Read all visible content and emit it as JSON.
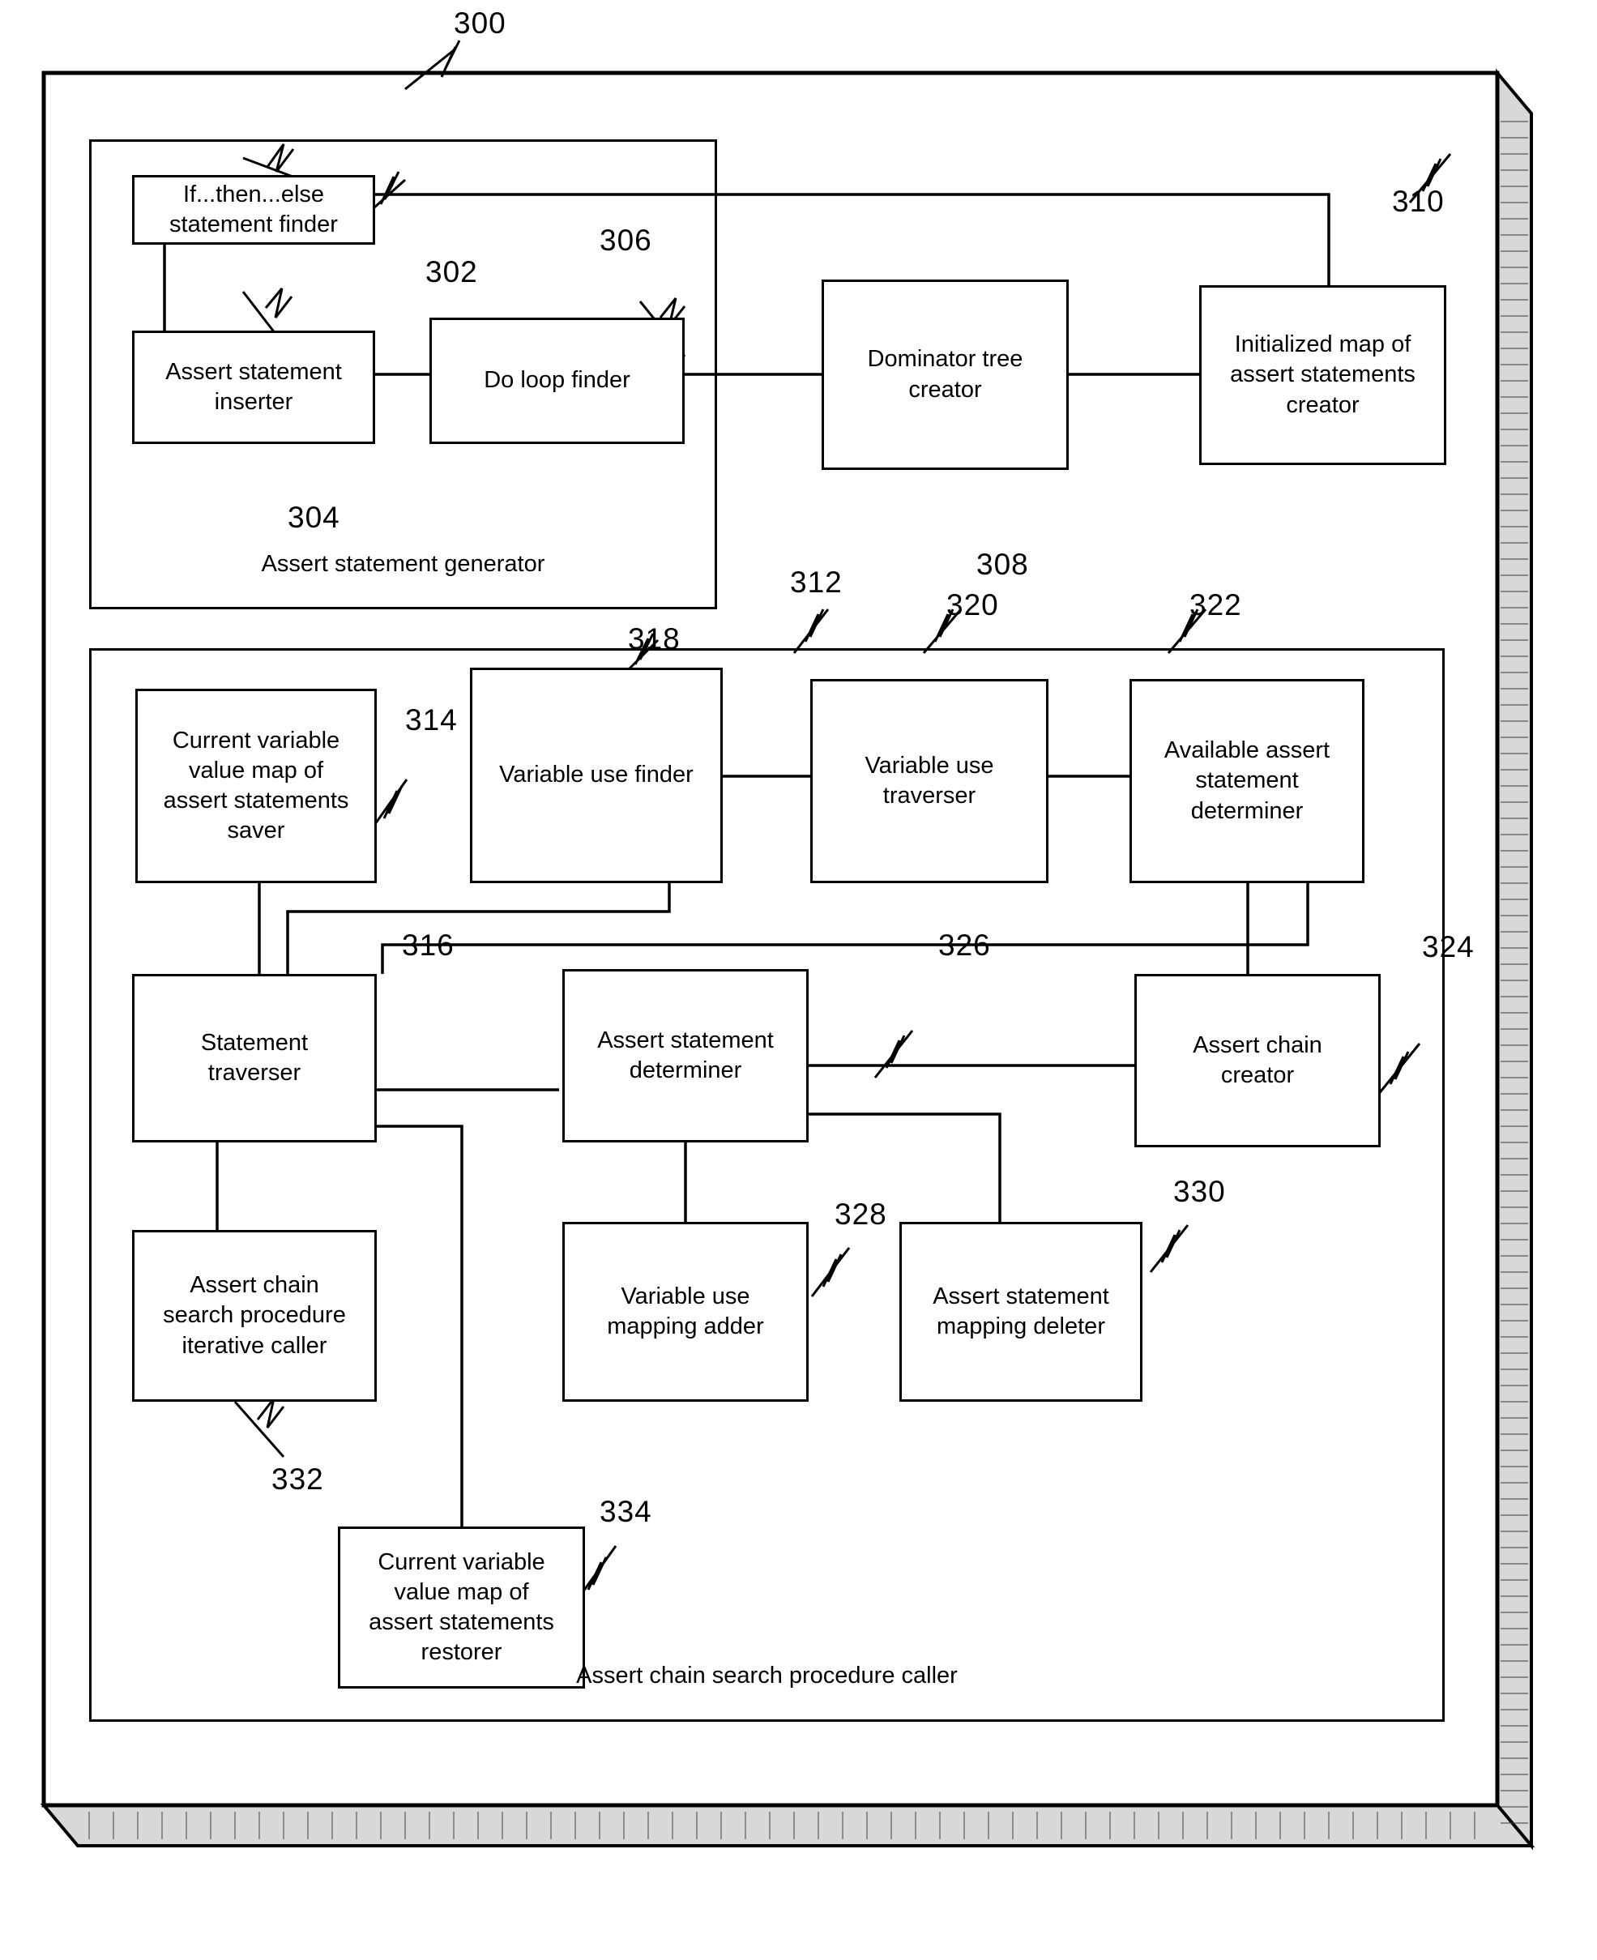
{
  "figure": {
    "main_ref": "300",
    "outer_frame": {
      "name": "system-frame"
    },
    "groups": [
      {
        "id": "assert-statement-generator",
        "label": "Assert statement generator"
      },
      {
        "id": "assert-chain-search-procedure-caller",
        "label": "Assert chain search procedure caller"
      }
    ],
    "nodes": [
      {
        "id": "if-then-else-statement-finder",
        "label": "If...then...else statement finder",
        "ref": "302"
      },
      {
        "id": "assert-statement-inserter",
        "label": "Assert statement inserter",
        "ref": "304"
      },
      {
        "id": "do-loop-finder",
        "label": "Do loop finder",
        "ref": "306"
      },
      {
        "id": "dominator-tree-creator",
        "label": "Dominator tree creator",
        "ref": "308"
      },
      {
        "id": "initialized-map-of-assert-statements-creator",
        "label": "Initialized map of assert statements creator",
        "ref": "310"
      },
      {
        "id": "current-variable-value-map-of-assert-statements-saver",
        "label": "Current variable value map of assert statements saver",
        "ref": "314"
      },
      {
        "id": "variable-use-finder",
        "label": "Variable use finder",
        "ref": "318"
      },
      {
        "id": "variable-use-traverser",
        "label": "Variable use traverser",
        "ref": "320"
      },
      {
        "id": "available-assert-statement-determiner",
        "label": "Available assert statement determiner",
        "ref": "322"
      },
      {
        "id": "statement-traverser",
        "label": "Statement traverser",
        "ref": "316"
      },
      {
        "id": "assert-statement-determiner",
        "label": "Assert statement determiner",
        "ref": "326"
      },
      {
        "id": "assert-chain-creator",
        "label": "Assert chain creator",
        "ref": "324"
      },
      {
        "id": "assert-chain-search-procedure-iterative-caller",
        "label": "Assert chain search procedure iterative caller",
        "ref": "332"
      },
      {
        "id": "variable-use-mapping-adder",
        "label": "Variable use mapping adder",
        "ref": "328"
      },
      {
        "id": "assert-statement-mapping-deleter",
        "label": "Assert statement mapping deleter",
        "ref": "330"
      },
      {
        "id": "current-variable-value-map-of-assert-statements-restorer",
        "label": "Current variable value map of assert statements restorer",
        "ref": "334"
      }
    ],
    "reference_numerals": {
      "n300": "300",
      "n302": "302",
      "n304": "304",
      "n306": "306",
      "n308": "308",
      "n310": "310",
      "n312": "312",
      "n314": "314",
      "n316": "316",
      "n318": "318",
      "n320": "320",
      "n322": "322",
      "n324": "324",
      "n326": "326",
      "n328": "328",
      "n330": "330",
      "n332": "332",
      "n334": "334"
    },
    "labels": {
      "node_if_then_else": "If...then...else\nstatement finder",
      "node_assert_statement_inserter": "Assert statement\ninserter",
      "node_do_loop_finder": "Do loop finder",
      "node_dominator_tree_creator": "Dominator tree\ncreator",
      "node_initialized_map": "Initialized map of\nassert statements\ncreator",
      "node_cvvm_saver": "Current variable\nvalue map of\nassert statements\nsaver",
      "node_variable_use_finder": "Variable use finder",
      "node_variable_use_traverser": "Variable use\ntraverser",
      "node_available_assert": "Available assert\nstatement\ndeterminer",
      "node_statement_traverser": "Statement\ntraverser",
      "node_assert_statement_determiner": "Assert statement\ndeterminer",
      "node_assert_chain_creator": "Assert chain\ncreator",
      "node_acs_iterative_caller": "Assert chain\nsearch procedure\niterative caller",
      "node_variable_use_mapping_adder": "Variable use\nmapping adder",
      "node_assert_stmt_mapping_deleter": "Assert statement\nmapping deleter",
      "node_cvvm_restorer": "Current variable\nvalue map of\nassert statements\nrestorer",
      "group_assert_statement_generator": "Assert statement generator",
      "group_acs_procedure_caller": "Assert chain search procedure caller"
    },
    "colors": {
      "line": "#000000",
      "background": "#ffffff",
      "shadow_fill": "#cfcfcf"
    }
  }
}
